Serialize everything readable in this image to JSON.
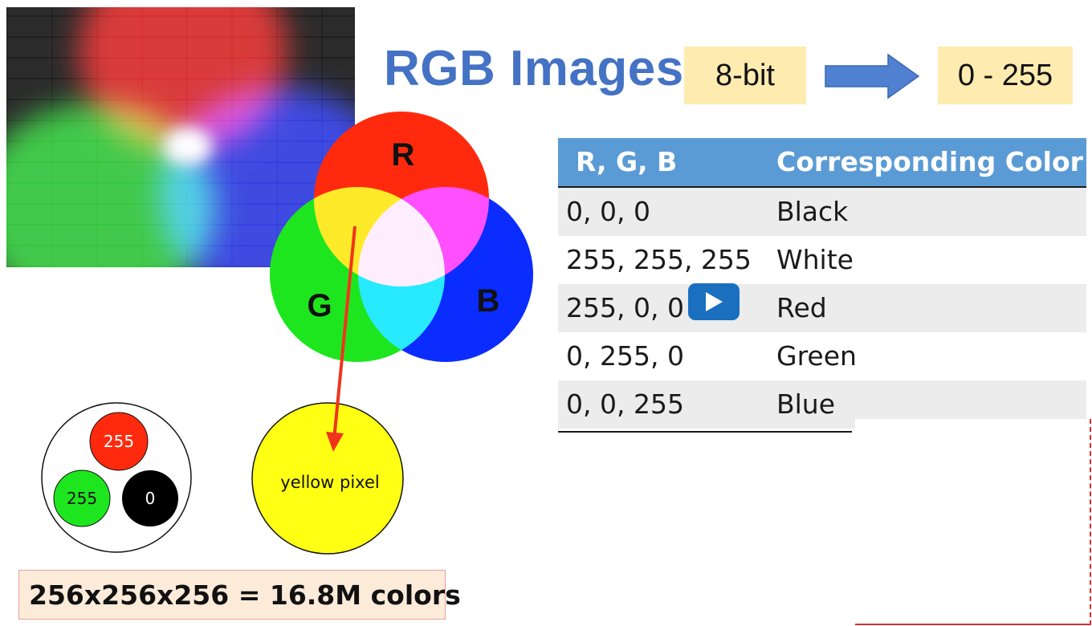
{
  "title": "RGB Images",
  "bit_depth": "8-bit",
  "value_range": "0 - 255",
  "table": {
    "headers": [
      "R, G, B",
      "Corresponding Color"
    ],
    "rows": [
      {
        "rgb": "0, 0, 0",
        "color": "Black"
      },
      {
        "rgb": "255, 255, 255",
        "color": "White"
      },
      {
        "rgb": "255, 0, 0",
        "color": "Red"
      },
      {
        "rgb": "0, 255, 0",
        "color": "Green"
      },
      {
        "rgb": "0, 0, 255",
        "color": "Blue"
      }
    ]
  },
  "venn": {
    "r": "R",
    "g": "G",
    "b": "B"
  },
  "pixel": {
    "red": "255",
    "green": "255",
    "blue": "0"
  },
  "yellow_pixel_label": "yellow pixel",
  "formula": "256x256x256 = 16.8M colors",
  "colors": {
    "title": "#4472c4",
    "table_header": "#5b9bd5",
    "highlight_box": "#fdebb0",
    "red": "#ff2a0d",
    "green": "#1ee61e",
    "blue": "#0a2cff",
    "yellow": "#ffff14"
  },
  "icons": {
    "play": "play-icon",
    "arrow": "right-arrow-icon"
  }
}
